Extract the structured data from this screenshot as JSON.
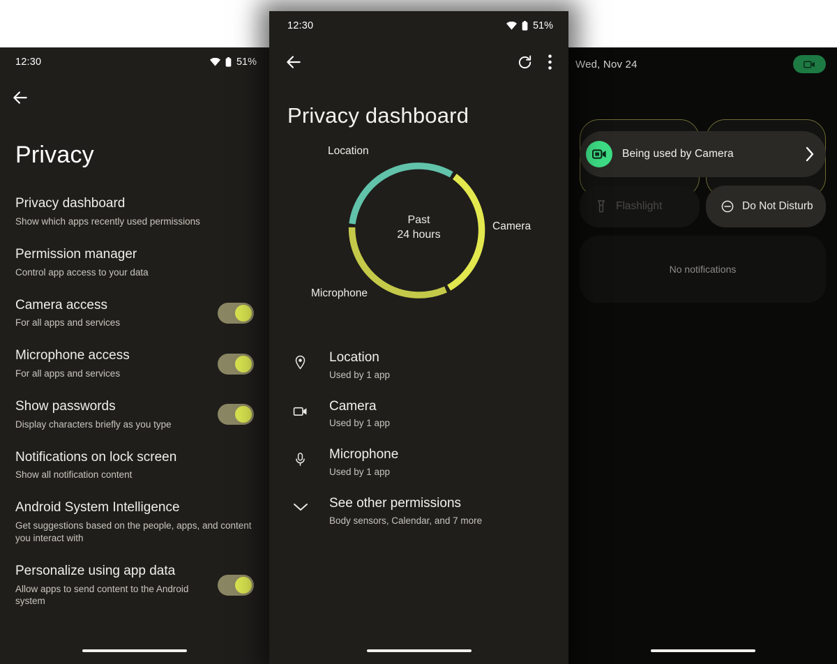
{
  "left_panel": {
    "status_bar": {
      "time": "12:30",
      "battery": "51%",
      "wifi_icon": "wifi-icon",
      "battery_icon": "battery-icon"
    },
    "back_icon": "back-arrow-icon",
    "title": "Privacy",
    "items": [
      {
        "title": "Privacy dashboard",
        "sub": "Show which apps recently used permissions",
        "toggle": false
      },
      {
        "title": "Permission manager",
        "sub": "Control app access to your data",
        "toggle": false
      },
      {
        "title": "Camera access",
        "sub": "For all apps and services",
        "toggle": true
      },
      {
        "title": "Microphone access",
        "sub": "For all apps and services",
        "toggle": true
      },
      {
        "title": "Show passwords",
        "sub": "Display characters briefly as you type",
        "toggle": true
      },
      {
        "title": "Notifications on lock screen",
        "sub": "Show all notification content",
        "toggle": false
      },
      {
        "title": "Android System Intelligence",
        "sub": "Get suggestions based on the people, apps, and content you interact with",
        "toggle": false
      },
      {
        "title": "Personalize using app data",
        "sub": "Allow apps to send content to the Android system",
        "toggle": true
      }
    ]
  },
  "center_panel": {
    "status_bar": {
      "time": "12:30",
      "battery": "51%",
      "wifi_icon": "wifi-icon",
      "battery_icon": "battery-icon"
    },
    "appbar": {
      "back_icon": "back-arrow-icon",
      "refresh_icon": "refresh-icon",
      "overflow_icon": "more-vertical-icon"
    },
    "title": "Privacy dashboard",
    "donut": {
      "center_line1": "Past",
      "center_line2": "24 hours",
      "label_location": "Location",
      "label_camera": "Camera",
      "label_microphone": "Microphone"
    },
    "items": [
      {
        "icon": "location-pin-icon",
        "name": "Location",
        "sub": "Used by 1 app"
      },
      {
        "icon": "video-camera-icon",
        "name": "Camera",
        "sub": "Used by 1 app"
      },
      {
        "icon": "microphone-icon",
        "name": "Microphone",
        "sub": "Used by 1 app"
      },
      {
        "icon": "chevron-down-icon",
        "name": "See other permissions",
        "sub": "Body sensors, Calendar, and 7 more"
      }
    ]
  },
  "right_panel": {
    "date": "Wed, Nov 24",
    "camera_pill_icon": "video-camera-icon",
    "banner": {
      "icon": "video-camera-icon",
      "text": "Being used by Camera",
      "chevron_icon": "chevron-right-icon"
    },
    "tiles": [
      {
        "label": "Flashlight",
        "icon": "flashlight-icon",
        "state": "off"
      },
      {
        "label": "Do Not Disturb",
        "icon": "do-not-disturb-icon",
        "state": "on"
      }
    ],
    "notifications_empty": "No notifications"
  },
  "chart_data": {
    "type": "pie",
    "title": "Privacy dashboard usage, past 24 hours",
    "center_label": "Past 24 hours",
    "categories": [
      "Location",
      "Camera",
      "Microphone"
    ],
    "values": [
      33,
      34,
      33
    ],
    "unit": "percent of ring",
    "colors": [
      "#62c3ab",
      "#e3e84f",
      "#c4c949"
    ],
    "legend": "inline labels around ring",
    "annotations": [
      "Location",
      "Camera",
      "Microphone"
    ]
  },
  "colors": {
    "panel_bg": "#1f1e1b",
    "shade_bg": "#0a0a09",
    "accent_yellow": "#d7e24f",
    "accent_olive": "#8a8663",
    "accent_green": "#3ddc84",
    "pill_green": "#1d7a43",
    "arc_teal": "#62c3ab",
    "arc_yellow": "#e3e84f",
    "arc_olive": "#c4c949"
  }
}
